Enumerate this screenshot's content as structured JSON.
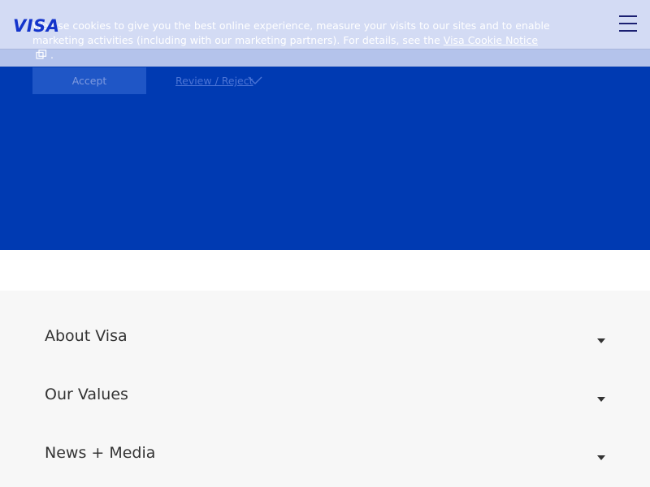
{
  "header": {
    "logo_text": "VISA",
    "menu_icon": "hamburger-menu-icon"
  },
  "cookie_banner": {
    "text": "We use cookies to give you the best online experience, measure your visits to our sites and to enable marketing activities (including with our marketing partners). For details, see the",
    "link_label": "Visa Cookie Notice",
    "link_icon": "external-link-icon",
    "trailing": ".",
    "accept_label": "Accept",
    "review_label": "Review / Reject",
    "review_icon": "chevron-down-icon"
  },
  "accordion": {
    "items": [
      {
        "label": "About Visa",
        "icon": "caret-down-icon"
      },
      {
        "label": "Our Values",
        "icon": "caret-down-icon"
      },
      {
        "label": "News + Media",
        "icon": "caret-down-icon"
      }
    ]
  },
  "colors": {
    "hero_blue": "#003ab2",
    "brand_blue": "#1434cb",
    "banner_overlay": "#cdd6f2",
    "footer_bg": "#f7f7f7"
  }
}
